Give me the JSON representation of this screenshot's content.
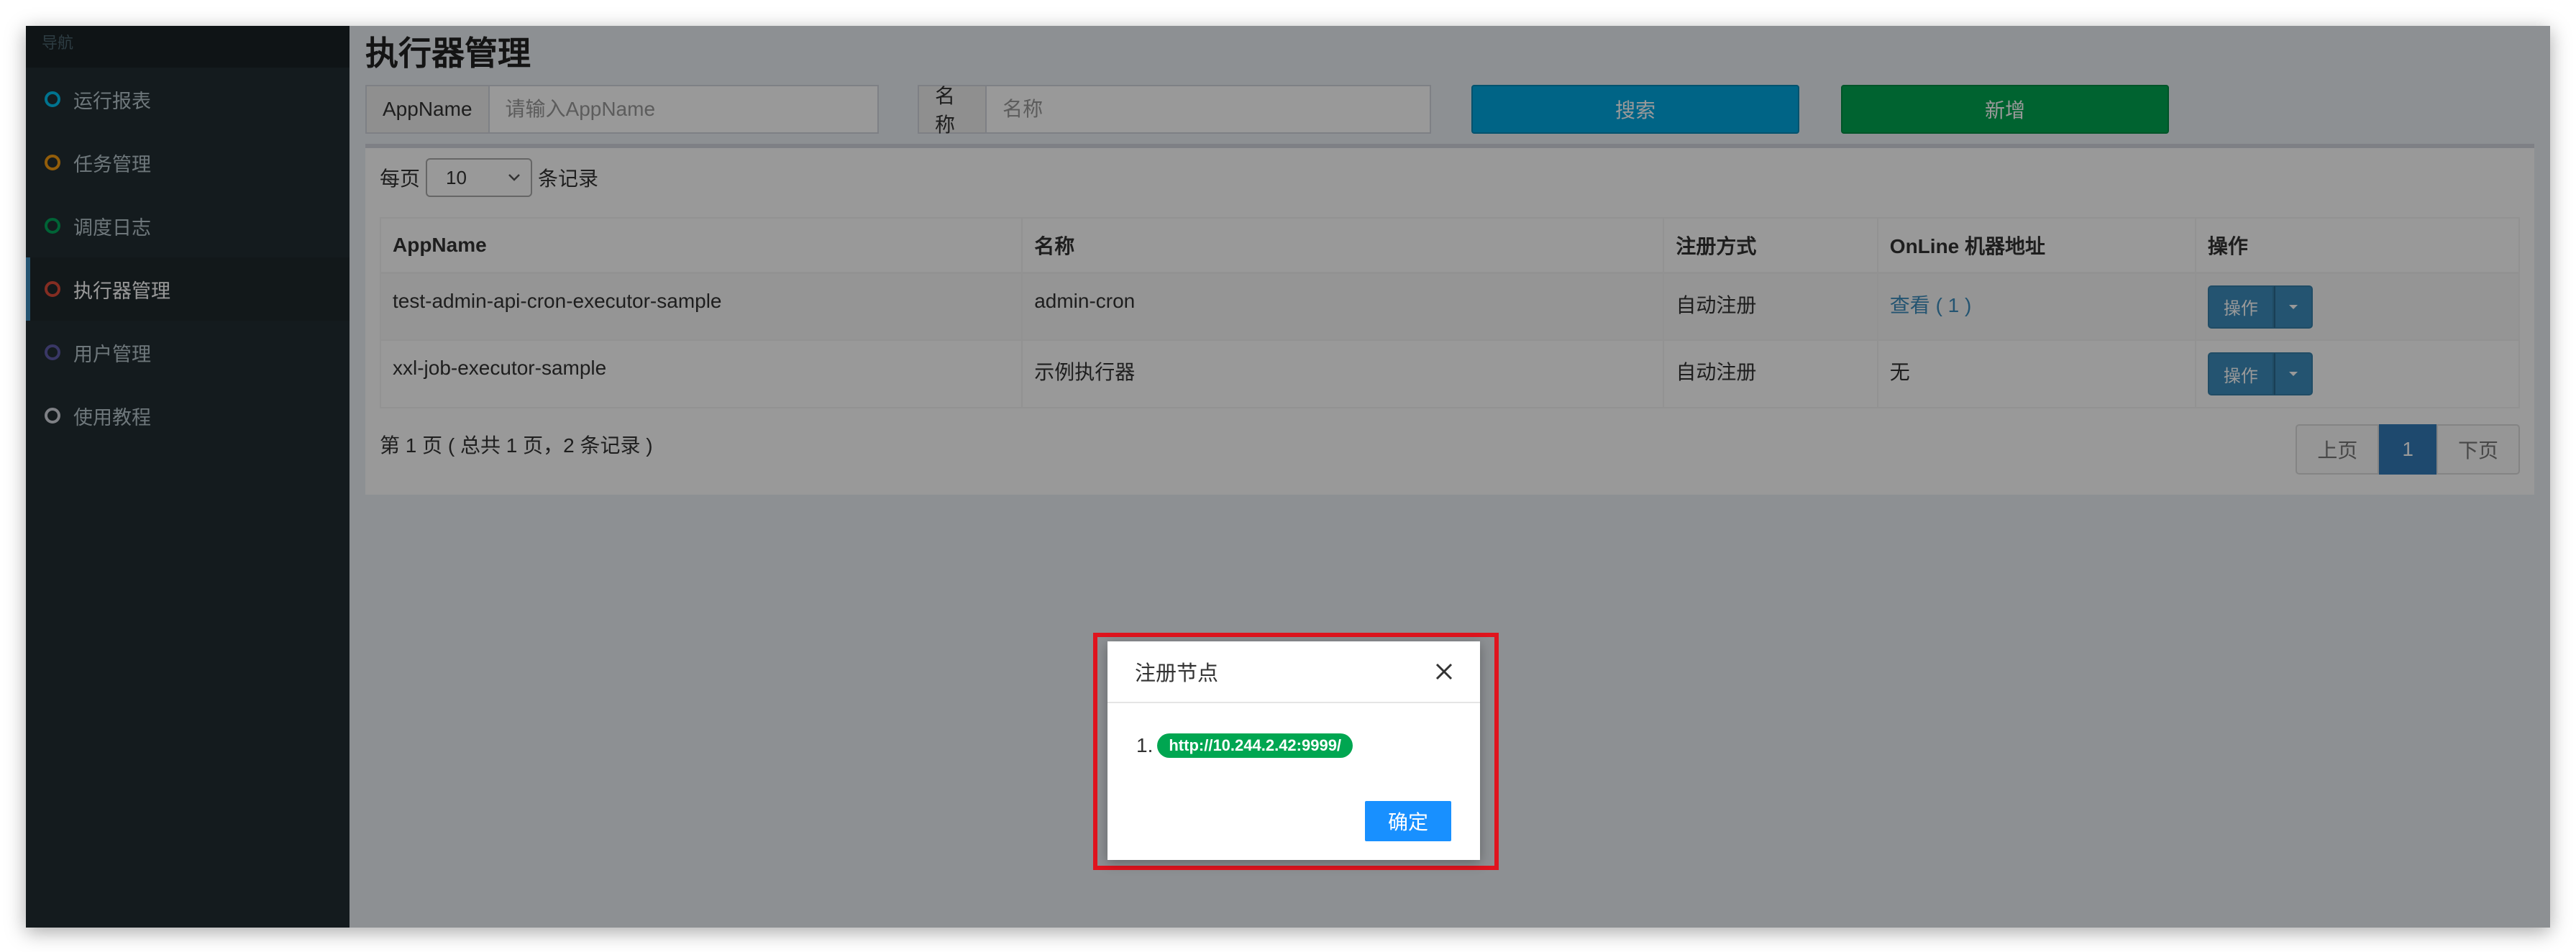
{
  "sidebar": {
    "header": "导航",
    "items": [
      {
        "label": "运行报表",
        "color": "#00c0ef"
      },
      {
        "label": "任务管理",
        "color": "#f39c12"
      },
      {
        "label": "调度日志",
        "color": "#00a65a"
      },
      {
        "label": "执行器管理",
        "color": "#dd4b39"
      },
      {
        "label": "用户管理",
        "color": "#605ca8"
      },
      {
        "label": "使用教程",
        "color": "#d2d6de"
      }
    ]
  },
  "page": {
    "title": "执行器管理"
  },
  "search": {
    "appname_label": "AppName",
    "appname_placeholder": "请输入AppName",
    "name_label": "名称",
    "name_placeholder": "名称",
    "search_button": "搜索",
    "add_button": "新增"
  },
  "table": {
    "length_prefix": "每页",
    "length_value": "10",
    "length_suffix": "条记录",
    "headers": [
      "AppName",
      "名称",
      "注册方式",
      "OnLine 机器地址",
      "操作"
    ],
    "rows": [
      {
        "appname": "test-admin-api-cron-executor-sample",
        "name": "admin-cron",
        "type": "自动注册",
        "online": "查看 ( 1 )",
        "op": "操作"
      },
      {
        "appname": "xxl-job-executor-sample",
        "name": "示例执行器",
        "type": "自动注册",
        "online": "无",
        "op": "操作"
      }
    ],
    "info": "第 1 页 ( 总共 1 页，2 条记录 )",
    "pager": {
      "prev": "上页",
      "current": "1",
      "next": "下页"
    }
  },
  "modal": {
    "title": "注册节点",
    "item_index": "1.",
    "item_address": "http://10.244.2.42:9999/",
    "ok_button": "确定"
  },
  "colors": {
    "accent": "#3c8dbc",
    "highlight_frame": "#e0141e",
    "ok_button": "#1890ff"
  }
}
